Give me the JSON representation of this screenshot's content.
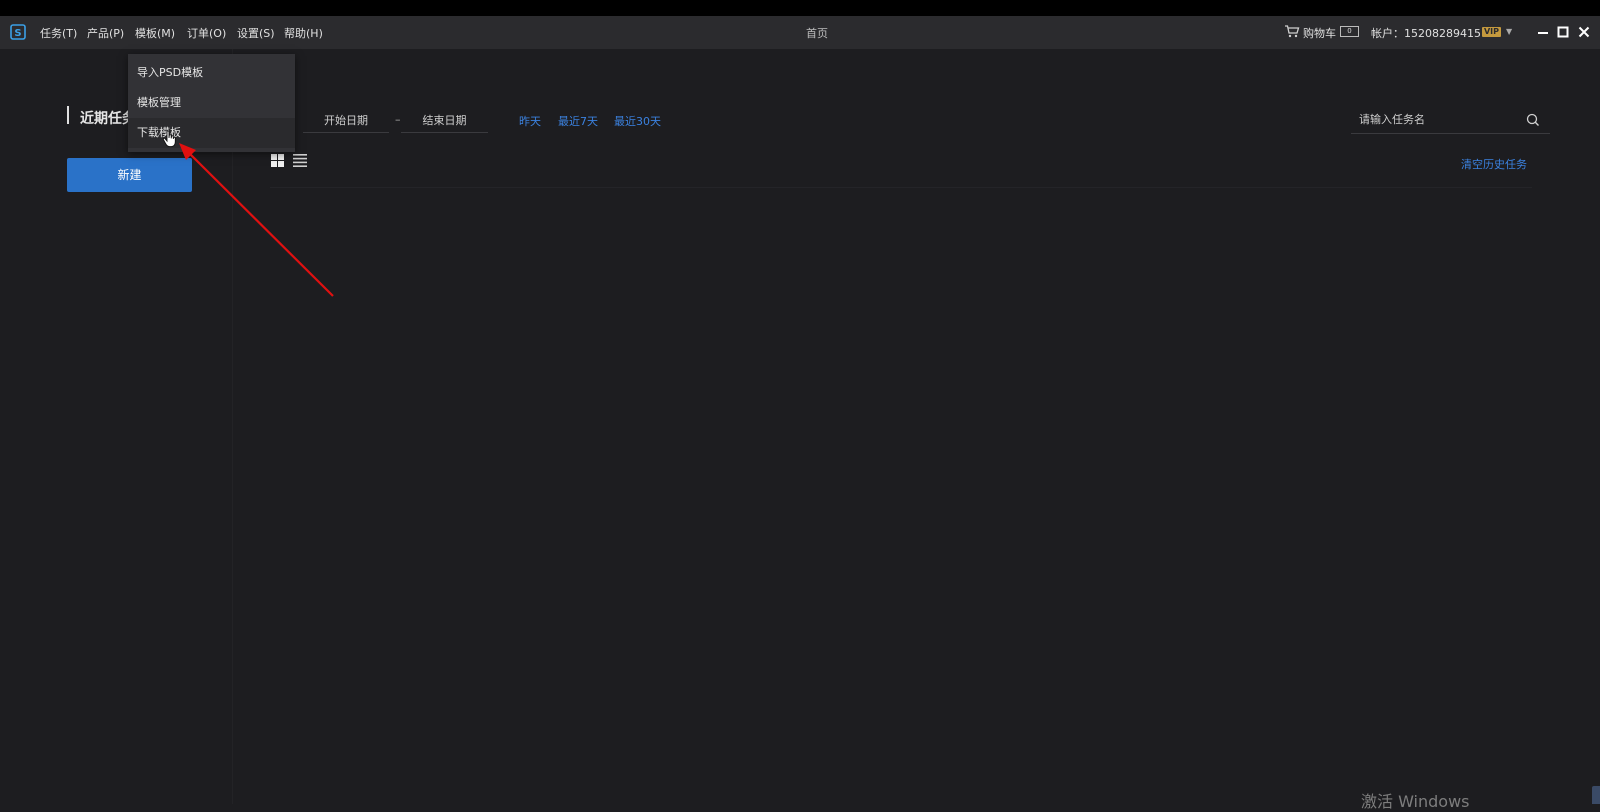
{
  "titlebar": {
    "menus": [
      "任务(T)",
      "产品(P)",
      "模板(M)",
      "订单(O)",
      "设置(S)",
      "帮助(H)"
    ],
    "title": "首页",
    "cart_label": "购物车",
    "cart_count": "0",
    "account": "帐户：15208289415",
    "vip": "VIP"
  },
  "sidebar": {
    "recent_title": "近期任务",
    "new_button": "新建"
  },
  "filters": {
    "start_date": "开始日期",
    "dash": "–",
    "end_date": "结束日期",
    "quick": [
      "昨天",
      "最近7天",
      "最近30天"
    ],
    "search_placeholder": "请输入任务名",
    "clear_history": "清空历史任务"
  },
  "dropdown": {
    "items": [
      "导入PSD模板",
      "模板管理",
      "下载模板"
    ],
    "hovered_index": 2
  },
  "watermark": "激活 Windows",
  "colors": {
    "accent": "#2a72c8",
    "link": "#3b82e0",
    "background": "#1d1d20",
    "titlebar": "#2b2b2e",
    "vip": "#c59a3e",
    "annotation_arrow": "#e01010"
  },
  "icons": [
    "app-logo-icon",
    "cart-icon",
    "minimize-icon",
    "maximize-icon",
    "close-icon",
    "search-icon",
    "grid-view-icon",
    "list-view-icon",
    "hand-cursor-icon"
  ]
}
